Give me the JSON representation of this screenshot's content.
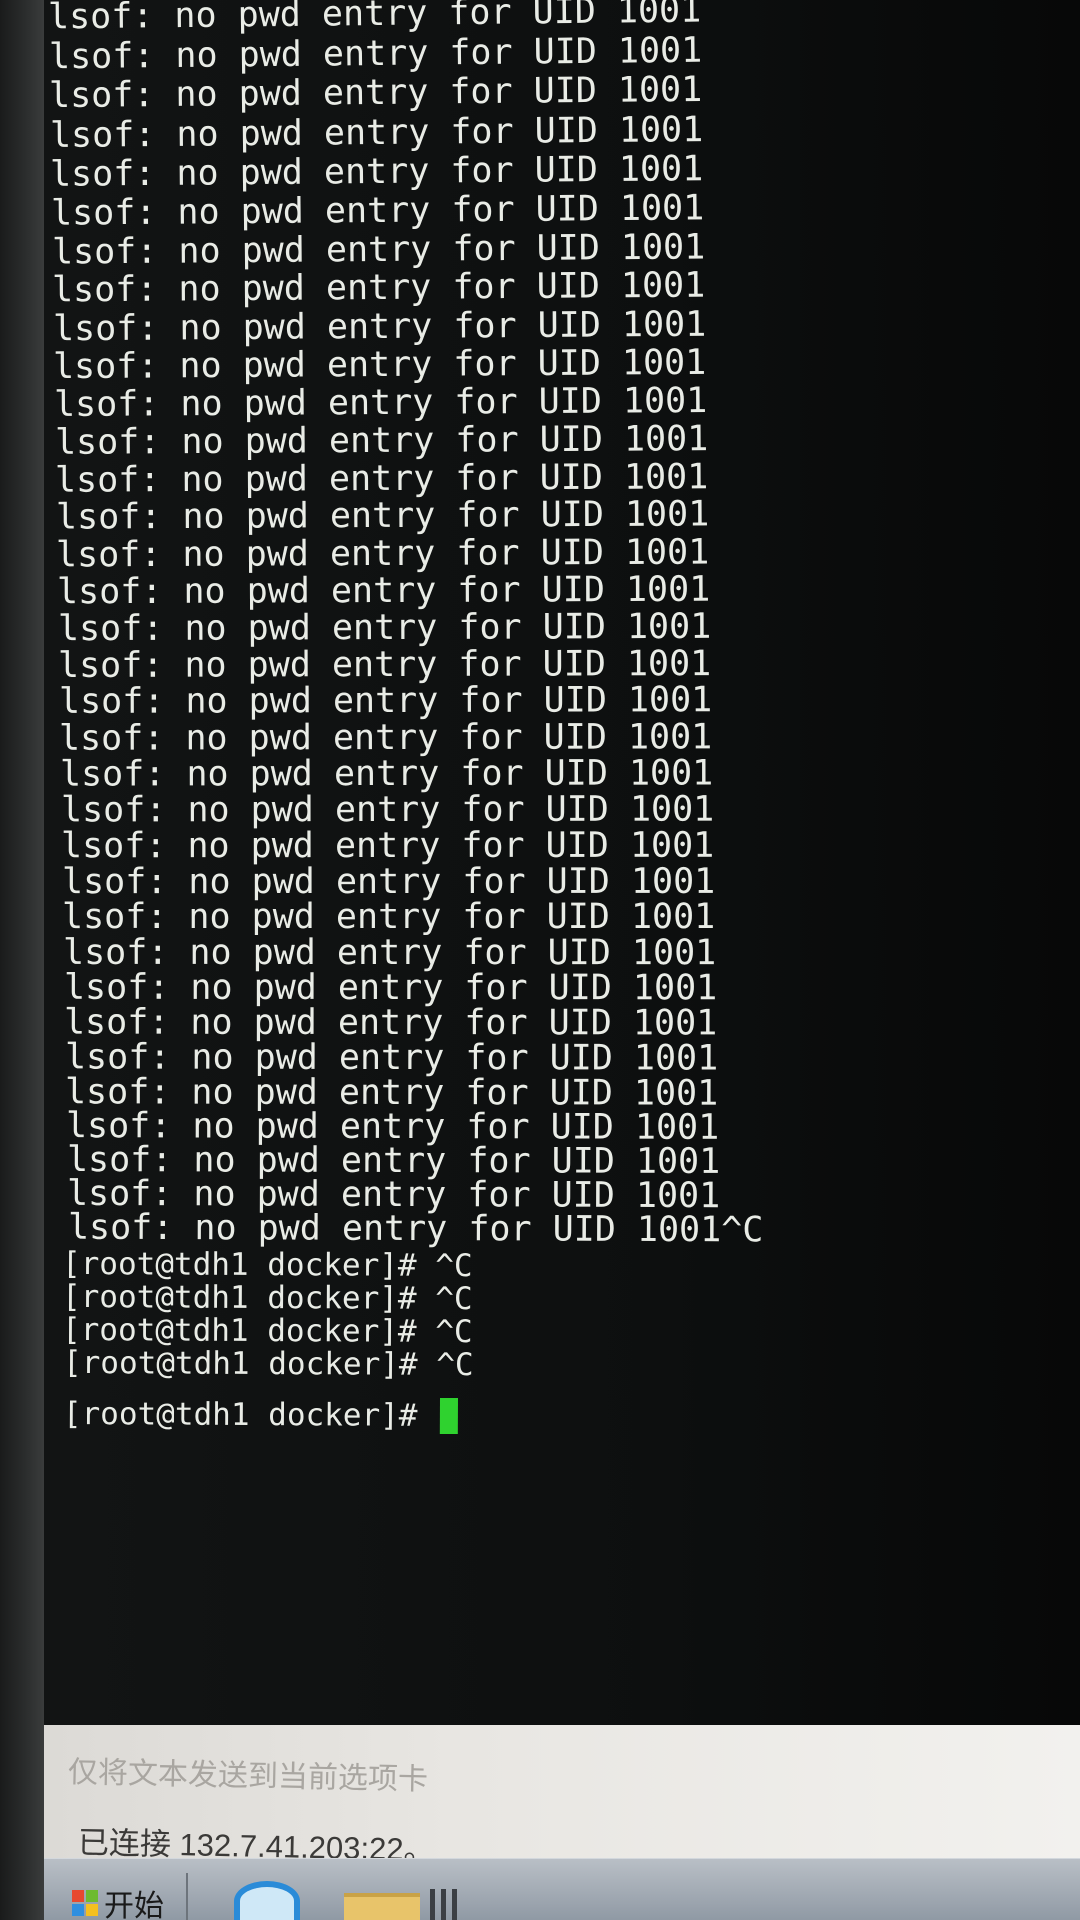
{
  "terminal": {
    "lines": [
      "lsof: no pwd entry for UID 1001",
      "lsof: no pwd entry for UID 1001",
      "lsof: no pwd entry for UID 1001",
      "lsof: no pwd entry for UID 1001",
      "lsof: no pwd entry for UID 1001",
      "lsof: no pwd entry for UID 1001",
      "lsof: no pwd entry for UID 1001",
      "lsof: no pwd entry for UID 1001",
      "lsof: no pwd entry for UID 1001",
      "lsof: no pwd entry for UID 1001",
      "lsof: no pwd entry for UID 1001",
      "lsof: no pwd entry for UID 1001",
      "lsof: no pwd entry for UID 1001",
      "lsof: no pwd entry for UID 1001",
      "lsof: no pwd entry for UID 1001",
      "lsof: no pwd entry for UID 1001",
      "lsof: no pwd entry for UID 1001",
      "lsof: no pwd entry for UID 1001",
      "lsof: no pwd entry for UID 1001",
      "lsof: no pwd entry for UID 1001",
      "lsof: no pwd entry for UID 1001",
      "lsof: no pwd entry for UID 1001",
      "lsof: no pwd entry for UID 1001",
      "lsof: no pwd entry for UID 1001",
      "lsof: no pwd entry for UID 1001",
      "lsof: no pwd entry for UID 1001",
      "lsof: no pwd entry for UID 1001",
      "lsof: no pwd entry for UID 1001",
      "lsof: no pwd entry for UID 1001",
      "lsof: no pwd entry for UID 1001",
      "lsof: no pwd entry for UID 1001",
      "lsof: no pwd entry for UID 1001",
      "lsof: no pwd entry for UID 1001",
      "lsof: no pwd entry for UID 1001^C",
      "",
      "[root@tdh1 docker]# ^C",
      "[root@tdh1 docker]# ^C",
      "[root@tdh1 docker]# ^C",
      "[root@tdh1 docker]# ^C",
      "[root@tdh1 docker]# "
    ],
    "cursor_color": "#2fd22f",
    "text_color": "#e9ece6"
  },
  "send_bar": {
    "placeholder": "仅将文本发送到当前选项卡"
  },
  "status": {
    "text": "已连接 132.7.41.203:22。"
  },
  "taskbar": {
    "start_label": "开始",
    "icons": [
      "windows-logo-icon",
      "internet-explorer-icon",
      "folder-icon"
    ]
  }
}
